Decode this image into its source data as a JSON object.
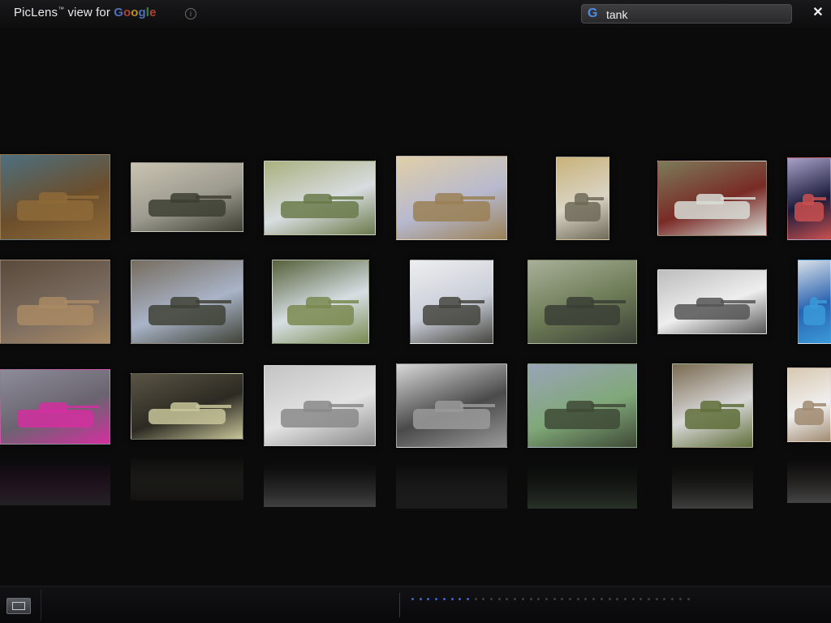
{
  "header": {
    "title_prefix": "PicLens",
    "title_tm": "™",
    "title_mid": " view for ",
    "brand": "Google",
    "info_icon": "i"
  },
  "search": {
    "icon": "google-g-icon",
    "icon_glyph": "G",
    "query": "tank"
  },
  "close": {
    "glyph": "✕"
  },
  "grid": {
    "rows": [
      [
        {
          "colors": [
            "#6b4e2c",
            "#8e6a38",
            "#4d7080"
          ]
        },
        {
          "colors": [
            "#9c9a8f",
            "#3d4032",
            "#c9c3b0"
          ]
        },
        {
          "colors": [
            "#d8dde0",
            "#6b7a4a",
            "#a9b07e"
          ]
        },
        {
          "colors": [
            "#b7b9cf",
            "#9a8055",
            "#e0cfa8"
          ]
        },
        {
          "colors": [
            "#d9d4c4",
            "#6f6a58",
            "#c9b27a"
          ]
        },
        {
          "colors": [
            "#7a2a26",
            "#d8dcd6",
            "#7b7c5a"
          ]
        },
        {
          "colors": [
            "#1a1b3a",
            "#c95050",
            "#a8a0c8"
          ]
        }
      ],
      [
        {
          "colors": [
            "#7a6b60",
            "#a98a64",
            "#5a4a3a"
          ]
        },
        {
          "colors": [
            "#a9b4c8",
            "#3f4236",
            "#766c5e"
          ]
        },
        {
          "colors": [
            "#d7dfe4",
            "#7a8a50",
            "#55603a"
          ]
        },
        {
          "colors": [
            "#c9ced9",
            "#45453e",
            "#eeeeee"
          ]
        },
        {
          "colors": [
            "#6c7a55",
            "#3a3f36",
            "#a8b098"
          ]
        },
        {
          "colors": [
            "#eeeeee",
            "#555555",
            "#bdbdbd"
          ]
        },
        {
          "colors": [
            "#2a62b0",
            "#3a9ad8",
            "#d8e0e8"
          ]
        }
      ],
      [
        {
          "colors": [
            "#6a6470",
            "#d42fa0",
            "#8c8c98"
          ]
        },
        {
          "colors": [
            "#2c2a22",
            "#c8c69a",
            "#5a5446"
          ]
        },
        {
          "colors": [
            "#e3e3e3",
            "#8a8a8a",
            "#c4c4c4"
          ]
        },
        {
          "colors": [
            "#4a4a4a",
            "#9a9a9a",
            "#d8d8d8"
          ]
        },
        {
          "colors": [
            "#7fa878",
            "#3f4a36",
            "#9aa4b8"
          ]
        },
        {
          "colors": [
            "#d8d8d8",
            "#5f6f3a",
            "#7a6a50"
          ]
        },
        {
          "colors": [
            "#f0f0f0",
            "#a08a70",
            "#d8c8b0"
          ]
        }
      ]
    ]
  },
  "pager": {
    "total_dots": 36,
    "active_dots": 8
  }
}
